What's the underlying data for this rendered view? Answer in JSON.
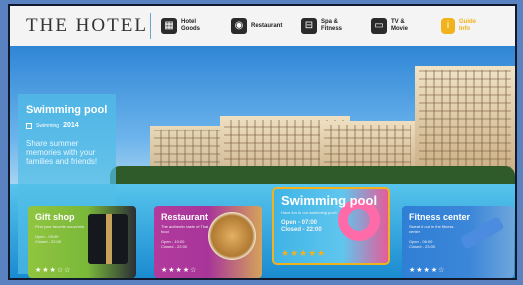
{
  "brand": "THE HOTEL",
  "nav": [
    {
      "icon": "hotel-goods-icon",
      "label": "Hotel\nGoods"
    },
    {
      "icon": "restaurant-icon",
      "label": "Restaurant"
    },
    {
      "icon": "spa-fitness-icon",
      "label": "Spa &\nFitness"
    },
    {
      "icon": "tv-movie-icon",
      "label": "TV &\nMovie"
    },
    {
      "icon": "info-icon",
      "label": "Guide\nInfo"
    }
  ],
  "side": {
    "title": "Swimming pool",
    "meta_label": "Swimming",
    "meta_value": "2014",
    "desc": "Share summer memories with your families and friends!"
  },
  "cards": {
    "gift": {
      "title": "Gift shop",
      "desc": "Find your favorite souvenirs",
      "hours": "Open - 09:00\nClosed - 22:00",
      "stars": "★★★☆☆"
    },
    "rest": {
      "title": "Restaurant",
      "desc": "The authentic taste of Thai food",
      "hours": "Open - 10:00\nClosed - 22:00",
      "stars": "★★★★☆"
    },
    "pool": {
      "title": "Swimming pool",
      "desc": "Have fun in our swimming pool!",
      "hours": "Open - 07:00\nClosed - 22:00",
      "stars": "★★★★★"
    },
    "fit": {
      "title": "Fitness center",
      "desc": "Sweat it out in the fitness center",
      "hours": "Open - 06:00\nClosed - 23:00",
      "stars": "★★★★☆"
    }
  },
  "colors": {
    "accent": "#f2b21b"
  }
}
